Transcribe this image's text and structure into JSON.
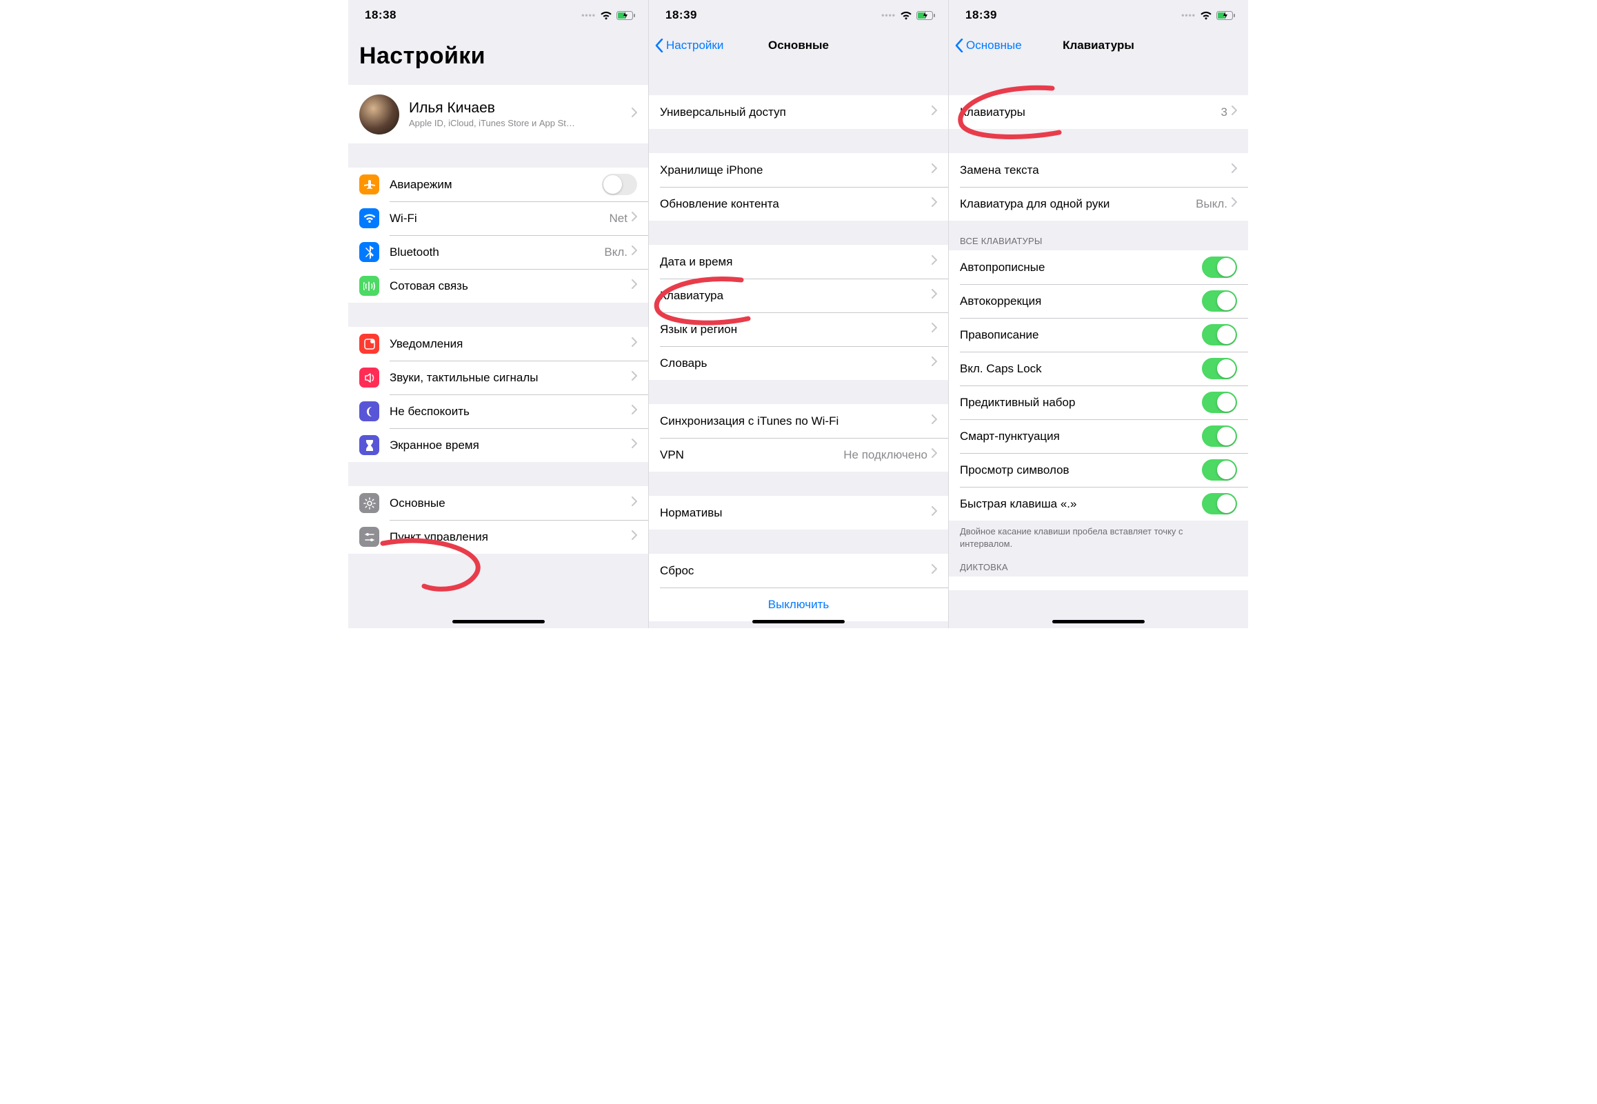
{
  "pane1": {
    "time": "18:38",
    "title": "Настройки",
    "profile": {
      "name": "Илья Кичаев",
      "subtitle": "Apple ID, iCloud, iTunes Store и App St…"
    },
    "rows1": [
      {
        "label": "Авиарежим",
        "toggle": false
      },
      {
        "label": "Wi-Fi",
        "detail": "Net"
      },
      {
        "label": "Bluetooth",
        "detail": "Вкл."
      },
      {
        "label": "Сотовая связь"
      }
    ],
    "rows2": [
      {
        "label": "Уведомления"
      },
      {
        "label": "Звуки, тактильные сигналы"
      },
      {
        "label": "Не беспокоить"
      },
      {
        "label": "Экранное время"
      }
    ],
    "rows3": [
      {
        "label": "Основные"
      },
      {
        "label": "Пункт управления"
      }
    ]
  },
  "pane2": {
    "time": "18:39",
    "back": "Настройки",
    "title": "Основные",
    "g1": [
      {
        "label": "Универсальный доступ"
      }
    ],
    "g2": [
      {
        "label": "Хранилище iPhone"
      },
      {
        "label": "Обновление контента"
      }
    ],
    "g3": [
      {
        "label": "Дата и время"
      },
      {
        "label": "Клавиатура"
      },
      {
        "label": "Язык и регион"
      },
      {
        "label": "Словарь"
      }
    ],
    "g4": [
      {
        "label": "Синхронизация с iTunes по Wi-Fi"
      },
      {
        "label": "VPN",
        "detail": "Не подключено"
      }
    ],
    "g5": [
      {
        "label": "Нормативы"
      }
    ],
    "g6": [
      {
        "label": "Сброс"
      }
    ],
    "shutdown": "Выключить"
  },
  "pane3": {
    "time": "18:39",
    "back": "Основные",
    "title": "Клавиатуры",
    "g1": [
      {
        "label": "Клавиатуры",
        "detail": "3"
      }
    ],
    "g2": [
      {
        "label": "Замена текста"
      },
      {
        "label": "Клавиатура для одной руки",
        "detail": "Выкл."
      }
    ],
    "allKbHeader": "ВСЕ КЛАВИАТУРЫ",
    "toggles": [
      {
        "label": "Автопрописные",
        "on": true
      },
      {
        "label": "Автокоррекция",
        "on": true
      },
      {
        "label": "Правописание",
        "on": true
      },
      {
        "label": "Вкл. Caps Lock",
        "on": true
      },
      {
        "label": "Предиктивный набор",
        "on": true
      },
      {
        "label": "Смарт-пунктуация",
        "on": true
      },
      {
        "label": "Просмотр символов",
        "on": true
      },
      {
        "label": "Быстрая клавиша «.»",
        "on": true
      }
    ],
    "footer": "Двойное касание клавиши пробела вставляет точку с интервалом.",
    "dictHeader": "ДИКТОВКА"
  }
}
